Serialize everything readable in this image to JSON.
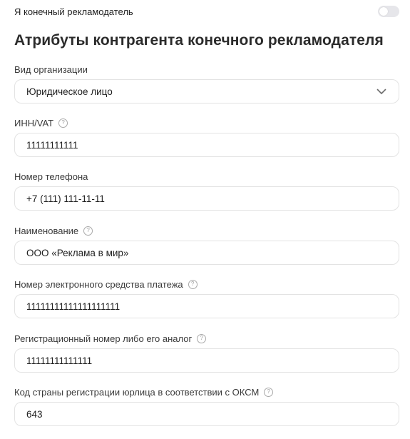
{
  "end_advertiser": {
    "label": "Я конечный рекламодатель",
    "toggle_on": false
  },
  "section": {
    "title": "Атрибуты контрагента конечного рекламодателя"
  },
  "fields": {
    "org_type": {
      "label": "Вид организации",
      "value": "Юридическое лицо",
      "icon": "chevron-down-icon"
    },
    "inn": {
      "label": "ИНН/VAT",
      "value": "11111111111",
      "help_icon": "?"
    },
    "phone": {
      "label": "Номер телефона",
      "value": "+7 (111) 111-11-11"
    },
    "name": {
      "label": "Наименование",
      "value": "ООО «Реклама в мир»",
      "help_icon": "?"
    },
    "payment_number": {
      "label": "Номер электронного средства платежа",
      "value": "11111111111111111111",
      "help_icon": "?"
    },
    "reg_number": {
      "label": "Регистрационный номер либо его аналог",
      "value": "11111111111111",
      "help_icon": "?"
    },
    "country_code": {
      "label": "Код страны регистрации юрлица в соответствии с ОКСМ",
      "value": "643",
      "help_icon": "?"
    }
  }
}
